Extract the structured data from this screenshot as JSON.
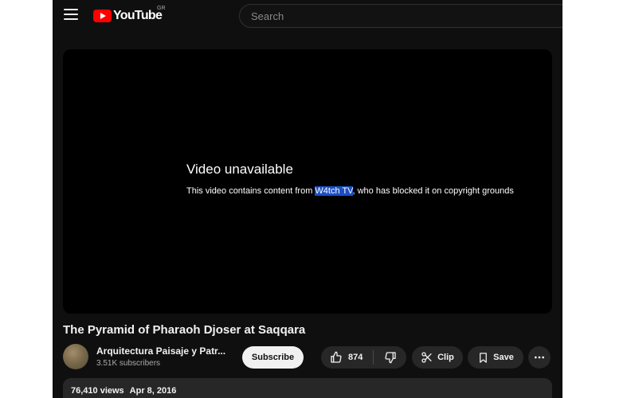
{
  "header": {
    "logo_text": "YouTube",
    "region_code": "GR",
    "search_placeholder": "Search"
  },
  "player": {
    "error_title": "Video unavailable",
    "error_message_before": "This video contains content from ",
    "error_highlight": "W4tch TV",
    "error_message_after": ", who has blocked it on copyright grounds"
  },
  "video": {
    "title": "The Pyramid of Pharaoh Djoser at Saqqara"
  },
  "channel": {
    "name": "Arquitectura Paisaje y Patr...",
    "subscribers": "3.51K subscribers",
    "subscribe_label": "Subscribe"
  },
  "actions": {
    "like_count": "874",
    "clip_label": "Clip",
    "save_label": "Save"
  },
  "description": {
    "views": "76,410 views",
    "date": "Apr 8, 2016"
  },
  "colors": {
    "background": "#0f0f0f",
    "brand_red": "#ff0000",
    "selection_highlight": "#1c4fc4"
  }
}
